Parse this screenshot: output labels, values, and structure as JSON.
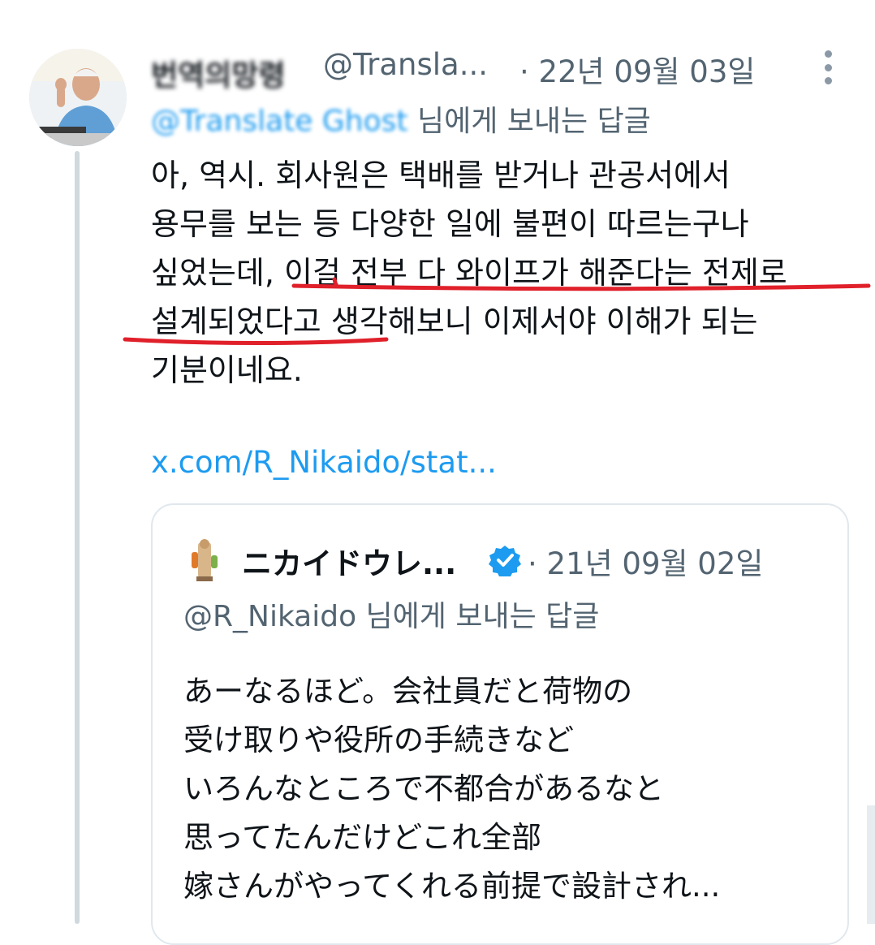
{
  "tweet": {
    "display_name": "번역의망령",
    "handle": "@Transla...",
    "date": "· 22년 09월 03일",
    "reply_prefix": "@Translate Ghost",
    "reply_suffix": " 님에게 보내는 답글",
    "body_lines": [
      "아, 역시. 회사원은 택배를 받거나 관공서에서",
      "용무를 보는 등 다양한 일에 불편이 따르는구나",
      "싶었는데, 이걸 전부 다 와이프가 해준다는 전제로",
      "설계되었다고 생각해보니 이제서야 이해가 되는",
      "기분이네요."
    ],
    "link": "x.com/R_Nikaido/stat...",
    "more_icon": "more-vertical-icon",
    "underline_color": "#e0202a"
  },
  "quote": {
    "name": "ニカイドウレ...",
    "date": "· 21년 09월 02일",
    "reply_to": "@R_Nikaido 님에게 보내는 답글",
    "lines": [
      "あーなるほど。会社員だと荷物の",
      "受け取りや役所の手続きなど",
      "いろんなところで不都合があるなと",
      "思ってたんだけどこれ全部",
      "嫁さんがやってくれる前提で設計され..."
    ],
    "verified_color": "#1d9bf0"
  }
}
